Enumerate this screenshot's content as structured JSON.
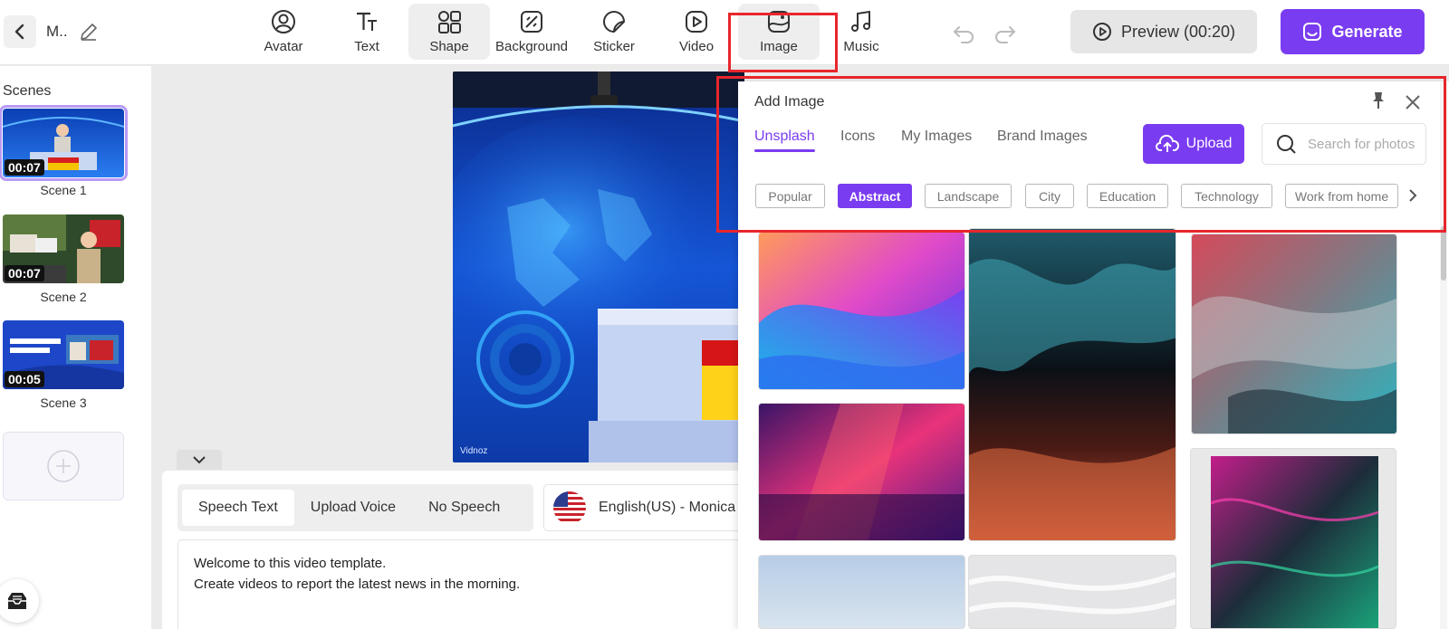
{
  "header": {
    "project_title": "M..",
    "tools": [
      {
        "label": "Avatar",
        "icon": "avatar-icon"
      },
      {
        "label": "Text",
        "icon": "text-icon"
      },
      {
        "label": "Shape",
        "icon": "shape-icon"
      },
      {
        "label": "Background",
        "icon": "background-icon"
      },
      {
        "label": "Sticker",
        "icon": "sticker-icon"
      },
      {
        "label": "Video",
        "icon": "video-icon"
      },
      {
        "label": "Image",
        "icon": "image-icon"
      },
      {
        "label": "Music",
        "icon": "music-icon"
      }
    ],
    "preview_label": "Preview (00:20)",
    "generate_label": "Generate"
  },
  "sidebar": {
    "title": "Scenes",
    "scenes": [
      {
        "name": "Scene 1",
        "duration": "00:07"
      },
      {
        "name": "Scene 2",
        "duration": "00:07"
      },
      {
        "name": "Scene 3",
        "duration": "00:05"
      }
    ]
  },
  "speech": {
    "tabs": [
      {
        "label": "Speech Text"
      },
      {
        "label": "Upload Voice"
      },
      {
        "label": "No Speech"
      }
    ],
    "voice": "English(US) - Monica",
    "lines": [
      "Welcome to this video template.",
      "Create videos to report the latest news in the morning."
    ]
  },
  "add_image": {
    "title": "Add Image",
    "tabs": [
      {
        "label": "Unsplash"
      },
      {
        "label": "Icons"
      },
      {
        "label": "My Images"
      },
      {
        "label": "Brand Images"
      }
    ],
    "upload_label": "Upload",
    "search_placeholder": "Search for photos",
    "categories": [
      {
        "label": "Popular"
      },
      {
        "label": "Abstract"
      },
      {
        "label": "Landscape"
      },
      {
        "label": "City"
      },
      {
        "label": "Education"
      },
      {
        "label": "Technology"
      },
      {
        "label": "Work from home"
      }
    ]
  },
  "theme": {
    "accent": "#7a3cf0",
    "highlight": "#e8262c"
  }
}
